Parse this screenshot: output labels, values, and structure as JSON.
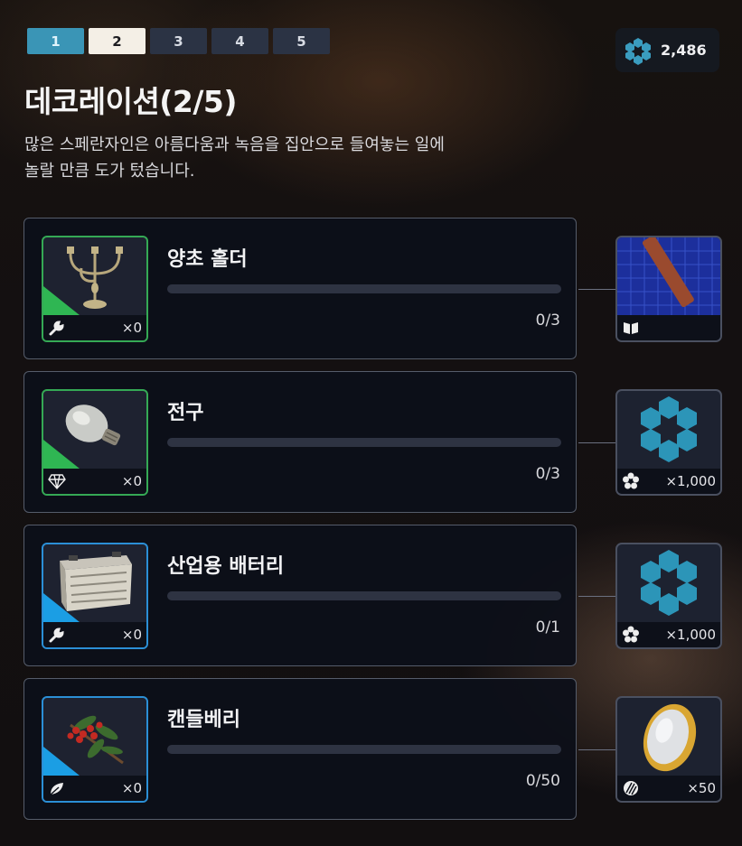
{
  "tabs": [
    {
      "label": "1",
      "state": "completed"
    },
    {
      "label": "2",
      "state": "selected"
    },
    {
      "label": "3",
      "state": "locked"
    },
    {
      "label": "4",
      "state": "locked"
    },
    {
      "label": "5",
      "state": "locked"
    }
  ],
  "currency": {
    "icon": "hex-cluster-icon",
    "amount": "2,486"
  },
  "title": "데코레이션(2/5)",
  "description_line1": "많은 스페란자인은 아름다움과 녹음을 집안으로 들여놓는 일에",
  "description_line2": "놀랄 만큼 도가 텄습니다.",
  "items": [
    {
      "name": "양초 홀더",
      "icon": "candelabra-icon",
      "rarity": "green",
      "type_icon": "wrench-icon",
      "owned": "×0",
      "progress": "0/3",
      "fraction": 0,
      "reward": {
        "icon": "blueprint-icon",
        "type_icon": "book-icon",
        "amount": ""
      }
    },
    {
      "name": "전구",
      "icon": "light-bulb-icon",
      "rarity": "green",
      "type_icon": "gem-icon",
      "owned": "×0",
      "progress": "0/3",
      "fraction": 0,
      "reward": {
        "icon": "hex-cluster-icon",
        "type_icon": "flower-icon",
        "amount": "×1,000"
      }
    },
    {
      "name": "산업용 배터리",
      "icon": "battery-icon",
      "rarity": "blue",
      "type_icon": "wrench-icon",
      "owned": "×0",
      "progress": "0/1",
      "fraction": 0,
      "reward": {
        "icon": "hex-cluster-icon",
        "type_icon": "flower-icon",
        "amount": "×1,000"
      }
    },
    {
      "name": "캔들베리",
      "icon": "candleberry-icon",
      "rarity": "blue",
      "type_icon": "leaf-icon",
      "owned": "×0",
      "progress": "0/50",
      "fraction": 0,
      "reward": {
        "icon": "coin-icon",
        "type_icon": "coin-stripe-icon",
        "amount": "×50"
      }
    }
  ],
  "colors": {
    "tab_completed": "#3a95b6",
    "tab_selected": "#f4efe6",
    "tab_locked": "#2b3344",
    "rarity_green": "#2fb653",
    "rarity_blue": "#1b9ee4",
    "hex_blue": "#2b8fb0"
  }
}
